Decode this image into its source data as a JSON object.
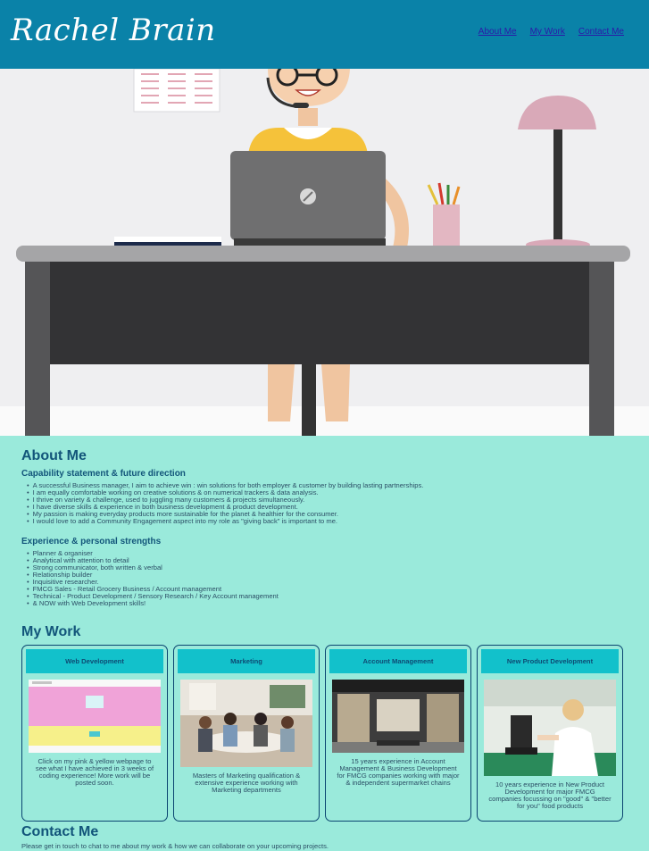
{
  "header": {
    "brand": "Rachel Brain",
    "nav": [
      "About Me",
      "My Work",
      "Contact Me"
    ]
  },
  "about": {
    "title": "About Me",
    "capability_title": "Capability statement & future direction",
    "capability_items": [
      "A successful Business manager, I aim to achieve win : win solutions for both employer & customer by building lasting partnerships.",
      "I am equally comfortable working on creative solutions & on numerical trackers & data analysis.",
      "I thrive on variety & challenge, used to juggling many customers & projects simultaneously.",
      "I have diverse skills & experience in both business development & product development.",
      "My passion is making everyday products more sustainable for the planet & healthier for the consumer.",
      "I would love to add a Community Engagement aspect into my role as \"giving back\" is important to me."
    ],
    "experience_title": "Experience & personal strengths",
    "experience_items": [
      "Planner & organiser",
      "Analytical with attention to detail",
      "Strong communicator, both written & verbal",
      "Relationship builder",
      "Inquisitive researcher.",
      "FMCG Sales - Retail Grocery Business / Account management",
      "Technical - Product Development / Sensory Research / Key Account management",
      "& NOW with Web Development skills!"
    ]
  },
  "work": {
    "title": "My Work",
    "cards": [
      {
        "title": "Web Development",
        "text": "Click on my pink & yellow webpage to see what I have achieved in 3 weeks of coding experience! More work will be posted soon."
      },
      {
        "title": "Marketing",
        "text": "Masters of Marketing qualification & extensive experience working with Marketing departments"
      },
      {
        "title": "Account Management",
        "text": "15 years experience in Account Management & Business Development for FMCG companies working with major & independent supermarket chains"
      },
      {
        "title": "New Product Development",
        "text": "10 years experience in New Product Development for major FMCG companies focussing on \"good\" & \"better for you\" food products"
      }
    ]
  },
  "contact": {
    "title": "Contact Me",
    "text": "Please get in touch to chat to me about my work & how we can collaborate on your upcoming projects."
  },
  "colors": {
    "header": "#0a82a8",
    "page_bg": "#9aeadb",
    "card_title_bg": "#12c1cb",
    "heading": "#12557a"
  }
}
